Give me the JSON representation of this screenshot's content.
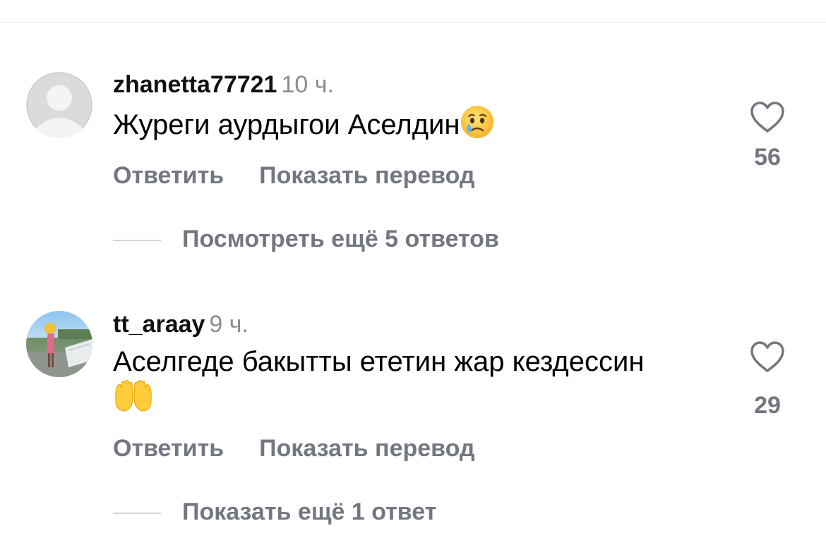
{
  "comments": [
    {
      "username": "zhanetta77721",
      "time": "10 ч.",
      "text": "Журеги аурдыгои Аселдин",
      "emoji": "crying-face",
      "reply_label": "Ответить",
      "translate_label": "Показать перевод",
      "likes": "56",
      "replies_label": "Посмотреть ещё 5 ответов",
      "avatar": "default-avatar"
    },
    {
      "username": "tt_araay",
      "time": "9 ч.",
      "text": "Аселгеде бакытты ететин жар кездессин",
      "emoji": "raising-hands",
      "reply_label": "Ответить",
      "translate_label": "Показать перевод",
      "likes": "29",
      "replies_label": "Показать ещё 1 ответ",
      "avatar": "photo-avatar"
    }
  ],
  "colors": {
    "secondary_text": "#737780",
    "timestamp": "#8a8d91",
    "divider": "#d5d6d8",
    "heart_stroke": "#737780"
  }
}
